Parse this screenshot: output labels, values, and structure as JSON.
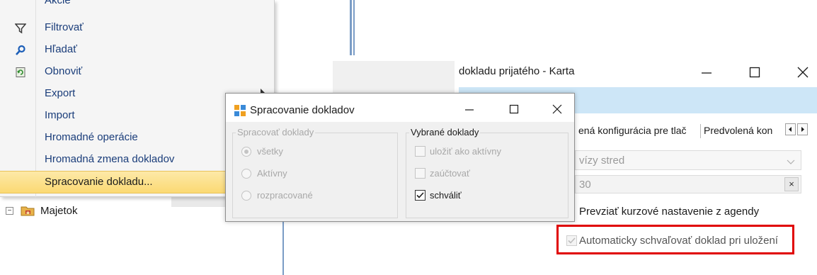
{
  "context_menu": {
    "items": [
      {
        "label": "Akcie",
        "icon": "none"
      },
      {
        "label": "Filtrovať",
        "icon": "filter-icon"
      },
      {
        "label": "Hľadať",
        "icon": "search-icon"
      },
      {
        "label": "Obnoviť",
        "icon": "refresh-icon"
      },
      {
        "label": "Export",
        "icon": "none",
        "submenu": true
      },
      {
        "label": "Import",
        "icon": "none"
      },
      {
        "label": "Hromadné operácie",
        "icon": "none"
      },
      {
        "label": "Hromadná zmena dokladov",
        "icon": "none"
      },
      {
        "label": "Spracovanie dokladu...",
        "icon": "none",
        "selected": true
      }
    ]
  },
  "tree": {
    "expander": "⊟",
    "label": "Majetok",
    "icon": "folder-icon"
  },
  "dialog": {
    "title": "Spracovanie dokladov",
    "group_left": {
      "title": "Spracovať doklady",
      "options": [
        "všetky",
        "Aktívny",
        "rozpracované"
      ],
      "selected": "všetky"
    },
    "group_right": {
      "title": "Vybrané doklady",
      "options": [
        {
          "label": "uložiť ako aktívny",
          "checked": false,
          "enabled": false
        },
        {
          "label": "zaúčtovať",
          "checked": false,
          "enabled": false
        },
        {
          "label": "schváliť",
          "checked": true,
          "enabled": true
        }
      ]
    }
  },
  "window2": {
    "title": "dokladu prijatého - Karta",
    "tabs": [
      "ená konfigurácia pre tlač",
      "Predvolená kon"
    ],
    "combo_value": "vízy stred",
    "text_value": "30",
    "clear_label": "×",
    "label_kurz": "Prevziať kurzové nastavenie z agendy",
    "checkbox_auto": {
      "label": "Automaticky schvaľovať doklad pri uložení",
      "checked": true,
      "enabled": false
    }
  },
  "colors": {
    "accent_blue_line": "#7a9cc6",
    "highlight_border": "#e00000",
    "menu_text": "#1a3d7a",
    "toolbar_strip": "#cde6f7",
    "selected_item": "#fbd973"
  }
}
